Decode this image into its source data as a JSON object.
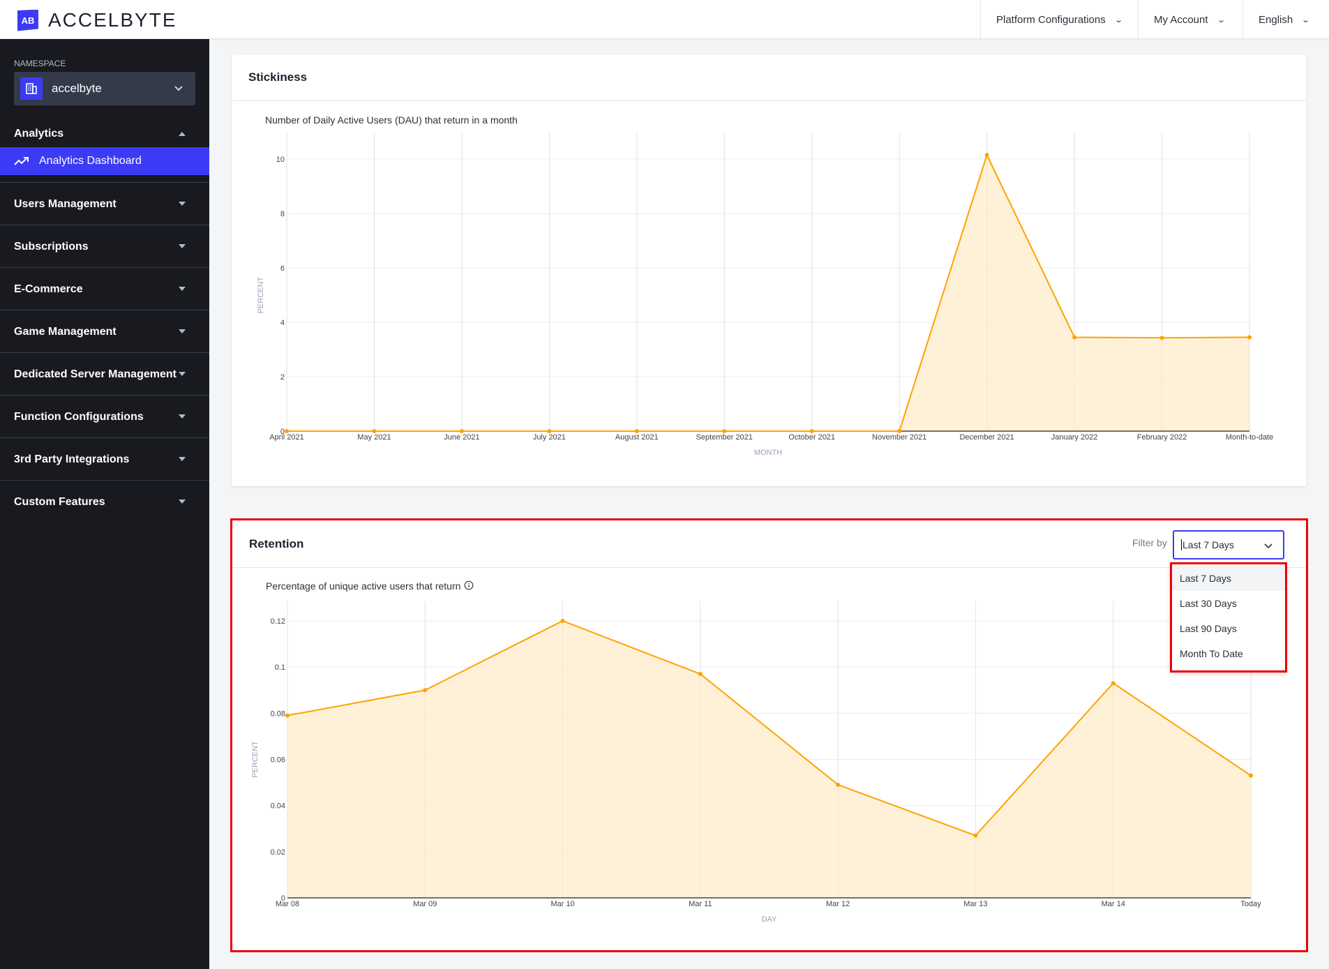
{
  "header": {
    "brand": "ACCELBYTE",
    "brand_mark": "AB",
    "nav": [
      {
        "label": "Platform Configurations"
      },
      {
        "label": "My Account"
      },
      {
        "label": "English"
      }
    ]
  },
  "sidebar": {
    "namespace_label": "NAMESPACE",
    "namespace_value": "accelbyte",
    "analytics": {
      "title": "Analytics",
      "active_item": "Analytics Dashboard"
    },
    "items": [
      {
        "label": "Users Management"
      },
      {
        "label": "Subscriptions"
      },
      {
        "label": "E-Commerce"
      },
      {
        "label": "Game Management"
      },
      {
        "label": "Dedicated Server Management"
      },
      {
        "label": "Function Configurations"
      },
      {
        "label": "3rd Party Integrations"
      },
      {
        "label": "Custom Features"
      }
    ]
  },
  "stickiness": {
    "title": "Stickiness",
    "subtitle": "Number of Daily Active Users (DAU) that return in a month"
  },
  "retention": {
    "title": "Retention",
    "subtitle": "Percentage of unique active users that return",
    "filter_label": "Filter by",
    "filter_value": "Last 7 Days",
    "filter_options": [
      "Last 7 Days",
      "Last 30 Days",
      "Last 90 Days",
      "Month To Date"
    ]
  },
  "colors": {
    "accent": "#3b3bf5",
    "series": "#ffa200",
    "area_fill": "#fff0d6",
    "highlight": "#ee0000"
  },
  "chart_data": [
    {
      "type": "area",
      "title": "Number of Daily Active Users (DAU) that return in a month",
      "xlabel": "MONTH",
      "ylabel": "PERCENT",
      "categories": [
        "April 2021",
        "May 2021",
        "June 2021",
        "July 2021",
        "August 2021",
        "September 2021",
        "October 2021",
        "November 2021",
        "December 2021",
        "January 2022",
        "February 2022",
        "Month-to-date"
      ],
      "values": [
        0,
        0,
        0,
        0,
        0,
        0,
        0,
        0,
        10.15,
        3.45,
        3.43,
        3.45
      ],
      "yticks": [
        0,
        2,
        4,
        6,
        8,
        10
      ],
      "ylim": [
        0,
        10
      ],
      "grid": true
    },
    {
      "type": "area",
      "title": "Percentage of unique active users that return",
      "xlabel": "DAY",
      "ylabel": "PERCENT",
      "categories": [
        "Mar 08",
        "Mar 09",
        "Mar 10",
        "Mar 11",
        "Mar 12",
        "Mar 13",
        "Mar 14",
        "Today"
      ],
      "values": [
        0.079,
        0.09,
        0.12,
        0.097,
        0.049,
        0.027,
        0.093,
        0.053
      ],
      "yticks": [
        0,
        0.02,
        0.04,
        0.06,
        0.08,
        0.1,
        0.12
      ],
      "ylim": [
        0,
        0.12
      ],
      "grid": true
    }
  ]
}
